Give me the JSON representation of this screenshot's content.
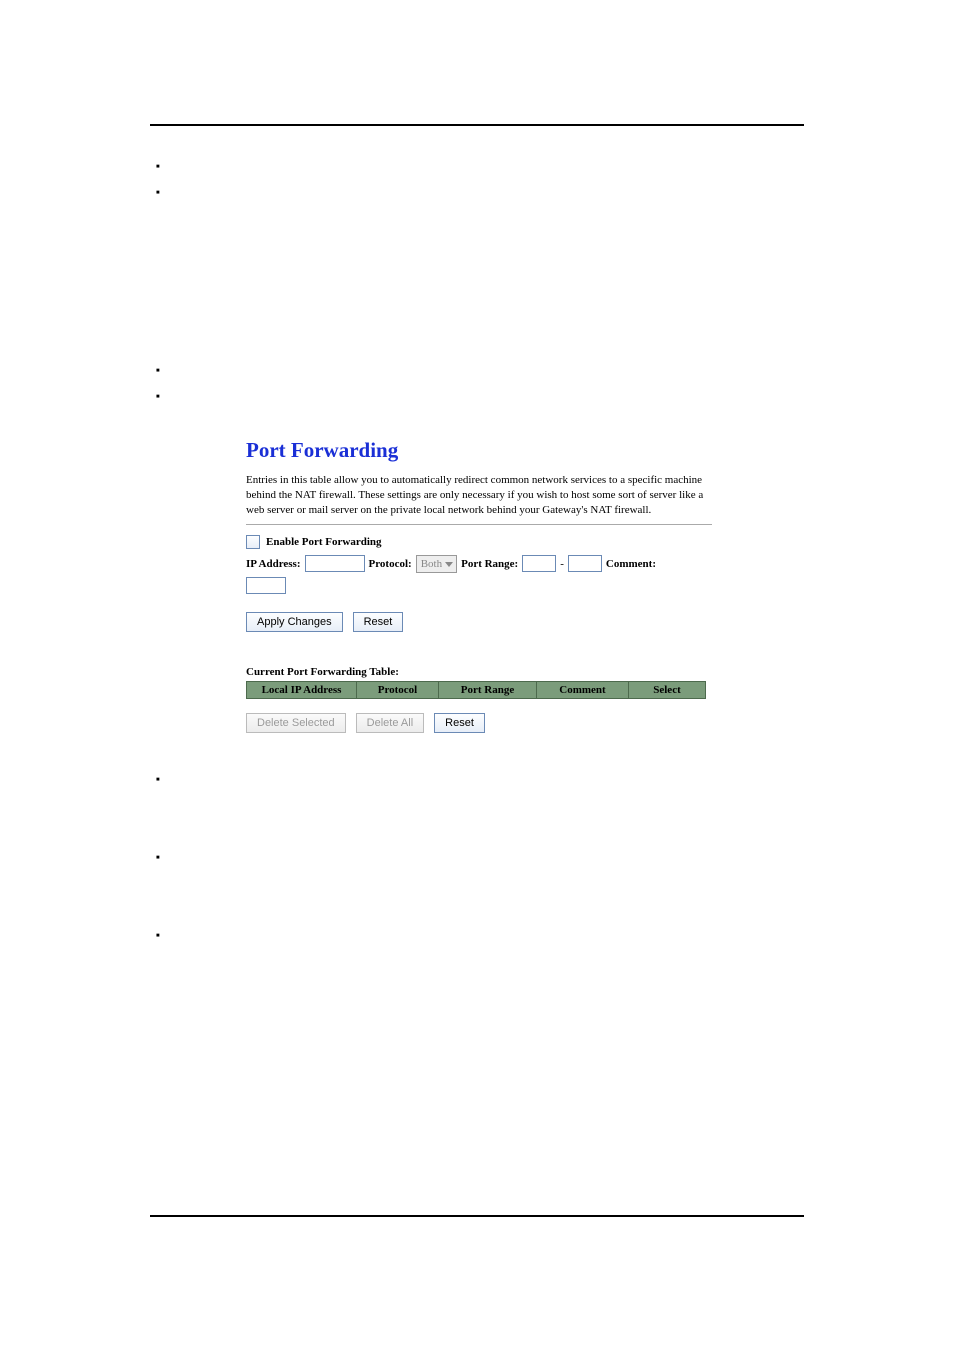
{
  "panel": {
    "title": "Port Forwarding",
    "description": "Entries in this table allow you to automatically redirect common network services to a specific machine behind the NAT firewall. These settings are only necessary if you wish to host some sort of server like a web server or mail server on the private local network behind your Gateway's NAT firewall.",
    "enable_label": "Enable Port Forwarding",
    "ip_label": "IP Address:",
    "protocol_label": "Protocol:",
    "protocol_value": "Both",
    "portrange_label": "Port Range:",
    "portrange_sep": "-",
    "comment_label": "Comment:",
    "apply_btn": "Apply Changes",
    "reset_btn": "Reset",
    "table_title": "Current Port Forwarding Table:",
    "cols": {
      "c1": "Local IP Address",
      "c2": "Protocol",
      "c3": "Port Range",
      "c4": "Comment",
      "c5": "Select"
    },
    "delete_selected_btn": "Delete Selected",
    "delete_all_btn": "Delete All",
    "reset2_btn": "Reset"
  }
}
